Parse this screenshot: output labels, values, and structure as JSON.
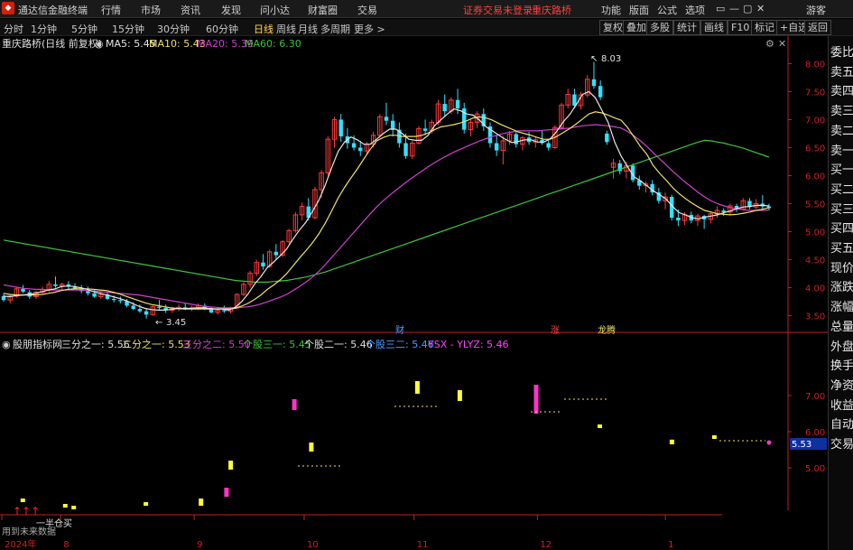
{
  "app": {
    "title": "通达信金融终端",
    "menu": [
      "行情",
      "市场",
      "资讯",
      "发现",
      "问小达",
      "财富圈",
      "交易"
    ],
    "status_left": "证券交易未登录",
    "status_stock": "重庆路桥",
    "menu_right": [
      "功能",
      "版面",
      "公式",
      "选项"
    ],
    "guest": "游客",
    "win_controls": [
      "▭",
      "—",
      "▢",
      "✕"
    ]
  },
  "tabs": [
    "分时",
    "1分钟",
    "5分钟",
    "15分钟",
    "30分钟",
    "60分钟",
    "日线",
    "周线",
    "月线",
    "多周期",
    "更多 >"
  ],
  "active_tab": "日线",
  "right_buttons": [
    "复权",
    "叠加",
    "多股",
    "统计",
    "画线",
    "F10",
    "标记",
    "+自选",
    "返回"
  ],
  "right_panel": [
    "委比",
    "卖五",
    "卖四",
    "卖三",
    "卖二",
    "卖一",
    "买一",
    "买二",
    "买三",
    "买四",
    "买五",
    "现价",
    "涨跌",
    "涨幅",
    "总量",
    "外盘",
    "换手",
    "净资",
    "收益",
    "自动",
    "交易"
  ],
  "main_header": {
    "name": "重庆路桥(日线 前复权)",
    "ma5": "MA5: 5.45",
    "ma10": "MA10: 5.43",
    "ma20": "MA20: 5.39",
    "ma60": "MA60: 6.30"
  },
  "sub_header": {
    "name": "股朋指标网",
    "s1": "三分之一: 5.56",
    "s2": "二分之一: 5.53",
    "s3": "三分之二: 5.50",
    "s4": "个股三一: 5.45",
    "s5": "个股二一: 5.46",
    "s6": "个股三二: 5.46",
    "s7": "YSX - YLYZ: 5.46"
  },
  "annotations": {
    "high_label": "8.03",
    "low_label": "3.45",
    "cai": "财",
    "zhang": "涨",
    "flags": "龙腾",
    "banner": "一半仓买",
    "notice": "用到未来数据",
    "current_price": "5.53"
  },
  "colors": {
    "up": "#ff3b3b",
    "down": "#33e0ff",
    "ma5": "#e6e6e6",
    "ma10": "#f0e068",
    "ma20": "#d040d0",
    "ma60": "#3cc43c",
    "axis": "#d02020",
    "sub_yellow": "#ffff33",
    "sub_magenta": "#ff33cc"
  },
  "chart_data": {
    "type": "candlestick",
    "title": "重庆路桥(日线 前复权)",
    "main_ylim": [
      3.3,
      8.2
    ],
    "main_yticks": [
      "8.00",
      "7.50",
      "7.00",
      "6.50",
      "6.00",
      "5.50",
      "5.00",
      "4.50",
      "4.00",
      "3.50"
    ],
    "sub_ylim": [
      3.8,
      8.2
    ],
    "sub_yticks": [
      "7.00",
      "6.00",
      "5.00"
    ],
    "x_labels": [
      "2024年",
      "8",
      "9",
      "10",
      "11",
      "12",
      "1"
    ],
    "candles": [
      [
        3.85,
        3.9,
        3.75,
        3.78
      ],
      [
        3.78,
        3.88,
        3.72,
        3.85
      ],
      [
        3.85,
        4.0,
        3.82,
        3.98
      ],
      [
        3.98,
        4.05,
        3.9,
        3.93
      ],
      [
        3.92,
        3.96,
        3.8,
        3.84
      ],
      [
        3.84,
        3.95,
        3.8,
        3.92
      ],
      [
        3.92,
        4.02,
        3.88,
        3.97
      ],
      [
        3.97,
        4.12,
        3.92,
        4.06
      ],
      [
        4.06,
        4.2,
        4.0,
        4.03
      ],
      [
        4.03,
        4.09,
        3.95,
        4.06
      ],
      [
        4.06,
        4.12,
        3.98,
        4.02
      ],
      [
        4.02,
        4.08,
        3.95,
        3.98
      ],
      [
        3.98,
        4.05,
        3.9,
        3.94
      ],
      [
        3.94,
        4.02,
        3.86,
        3.9
      ],
      [
        3.9,
        3.96,
        3.82,
        3.84
      ],
      [
        3.84,
        3.92,
        3.8,
        3.88
      ],
      [
        3.88,
        3.92,
        3.78,
        3.8
      ],
      [
        3.8,
        3.86,
        3.74,
        3.78
      ],
      [
        3.78,
        3.84,
        3.72,
        3.76
      ],
      [
        3.76,
        3.8,
        3.65,
        3.68
      ],
      [
        3.68,
        3.74,
        3.6,
        3.62
      ],
      [
        3.62,
        3.7,
        3.55,
        3.58
      ],
      [
        3.58,
        3.64,
        3.45,
        3.52
      ],
      [
        3.52,
        3.68,
        3.5,
        3.66
      ],
      [
        3.66,
        3.78,
        3.6,
        3.64
      ],
      [
        3.64,
        3.7,
        3.55,
        3.6
      ],
      [
        3.6,
        3.66,
        3.55,
        3.62
      ],
      [
        3.62,
        3.7,
        3.58,
        3.65
      ],
      [
        3.65,
        3.72,
        3.6,
        3.63
      ],
      [
        3.63,
        3.68,
        3.58,
        3.64
      ],
      [
        3.64,
        3.72,
        3.6,
        3.68
      ],
      [
        3.68,
        3.72,
        3.6,
        3.62
      ],
      [
        3.62,
        3.66,
        3.54,
        3.56
      ],
      [
        3.56,
        3.64,
        3.52,
        3.6
      ],
      [
        3.6,
        3.68,
        3.55,
        3.58
      ],
      [
        3.58,
        3.66,
        3.54,
        3.64
      ],
      [
        3.64,
        3.9,
        3.62,
        3.88
      ],
      [
        3.88,
        4.1,
        3.85,
        4.06
      ],
      [
        4.06,
        4.3,
        4.0,
        4.26
      ],
      [
        4.26,
        4.5,
        4.2,
        4.45
      ],
      [
        4.45,
        4.6,
        4.32,
        4.38
      ],
      [
        4.38,
        4.68,
        4.35,
        4.64
      ],
      [
        4.64,
        4.78,
        4.5,
        4.58
      ],
      [
        4.58,
        4.85,
        4.55,
        4.82
      ],
      [
        4.82,
        5.05,
        4.78,
        5.02
      ],
      [
        5.02,
        5.35,
        4.98,
        5.3
      ],
      [
        5.3,
        5.52,
        5.2,
        5.45
      ],
      [
        5.45,
        5.6,
        5.2,
        5.25
      ],
      [
        5.25,
        5.8,
        5.22,
        5.75
      ],
      [
        5.75,
        6.1,
        5.6,
        6.05
      ],
      [
        6.05,
        6.7,
        6.0,
        6.65
      ],
      [
        6.65,
        7.05,
        6.5,
        7.0
      ],
      [
        7.0,
        7.1,
        6.6,
        6.7
      ],
      [
        6.7,
        6.85,
        6.48,
        6.58
      ],
      [
        6.58,
        6.72,
        6.45,
        6.5
      ],
      [
        6.5,
        6.62,
        6.35,
        6.44
      ],
      [
        6.44,
        6.6,
        6.38,
        6.56
      ],
      [
        6.56,
        6.78,
        6.5,
        6.72
      ],
      [
        6.72,
        7.1,
        6.68,
        7.05
      ],
      [
        7.05,
        7.3,
        6.9,
        6.98
      ],
      [
        6.98,
        7.1,
        6.7,
        6.82
      ],
      [
        6.82,
        6.95,
        6.5,
        6.58
      ],
      [
        6.58,
        6.75,
        6.3,
        6.35
      ],
      [
        6.35,
        6.62,
        6.3,
        6.58
      ],
      [
        6.58,
        6.88,
        6.55,
        6.84
      ],
      [
        6.84,
        7.0,
        6.72,
        6.8
      ],
      [
        6.8,
        7.0,
        6.75,
        6.95
      ],
      [
        6.95,
        7.35,
        6.9,
        7.28
      ],
      [
        7.28,
        7.45,
        7.05,
        7.15
      ],
      [
        7.15,
        7.4,
        7.1,
        7.35
      ],
      [
        7.35,
        7.55,
        7.1,
        7.2
      ],
      [
        7.2,
        7.3,
        6.75,
        6.82
      ],
      [
        6.82,
        7.0,
        6.7,
        6.95
      ],
      [
        6.95,
        7.15,
        6.85,
        7.1
      ],
      [
        7.1,
        7.2,
        6.8,
        6.88
      ],
      [
        6.88,
        6.95,
        6.5,
        6.58
      ],
      [
        6.58,
        6.72,
        6.35,
        6.45
      ],
      [
        6.45,
        6.7,
        6.2,
        6.62
      ],
      [
        6.62,
        6.8,
        6.55,
        6.74
      ],
      [
        6.74,
        6.8,
        6.5,
        6.56
      ],
      [
        6.56,
        6.7,
        6.45,
        6.68
      ],
      [
        6.68,
        6.78,
        6.55,
        6.6
      ],
      [
        6.6,
        6.7,
        6.5,
        6.64
      ],
      [
        6.64,
        6.8,
        6.55,
        6.58
      ],
      [
        6.58,
        6.65,
        6.45,
        6.5
      ],
      [
        6.5,
        6.9,
        6.48,
        6.86
      ],
      [
        6.86,
        7.3,
        6.82,
        7.26
      ],
      [
        7.26,
        7.55,
        7.2,
        7.45
      ],
      [
        7.45,
        7.55,
        7.2,
        7.25
      ],
      [
        7.25,
        7.5,
        7.18,
        7.44
      ],
      [
        7.44,
        7.8,
        7.4,
        7.72
      ],
      [
        7.72,
        8.03,
        7.55,
        7.6
      ],
      [
        7.6,
        7.7,
        7.35,
        7.4
      ],
      [
        6.75,
        6.8,
        6.55,
        6.6
      ],
      [
        6.15,
        6.3,
        5.95,
        6.22
      ],
      [
        6.22,
        6.28,
        6.02,
        6.08
      ],
      [
        6.08,
        6.25,
        5.95,
        6.18
      ],
      [
        6.18,
        6.22,
        5.88,
        5.92
      ],
      [
        5.92,
        6.0,
        5.75,
        5.82
      ],
      [
        5.82,
        5.9,
        5.7,
        5.85
      ],
      [
        5.85,
        5.92,
        5.65,
        5.7
      ],
      [
        5.7,
        5.78,
        5.5,
        5.55
      ],
      [
        5.55,
        5.7,
        5.4,
        5.62
      ],
      [
        5.62,
        5.66,
        5.2,
        5.25
      ],
      [
        5.25,
        5.4,
        5.1,
        5.2
      ],
      [
        5.2,
        5.35,
        5.12,
        5.3
      ],
      [
        5.3,
        5.36,
        5.15,
        5.2
      ],
      [
        5.2,
        5.32,
        5.1,
        5.28
      ],
      [
        5.28,
        5.3,
        5.05,
        5.22
      ],
      [
        5.22,
        5.35,
        5.15,
        5.32
      ],
      [
        5.32,
        5.45,
        5.25,
        5.38
      ],
      [
        5.38,
        5.42,
        5.28,
        5.35
      ],
      [
        5.35,
        5.5,
        5.3,
        5.46
      ],
      [
        5.46,
        5.5,
        5.35,
        5.4
      ],
      [
        5.4,
        5.6,
        5.38,
        5.55
      ],
      [
        5.55,
        5.6,
        5.4,
        5.44
      ],
      [
        5.44,
        5.58,
        5.4,
        5.5
      ],
      [
        5.5,
        5.65,
        5.38,
        5.45
      ],
      [
        5.45,
        5.5,
        5.38,
        5.42
      ]
    ],
    "ma5": [
      3.85,
      3.84,
      3.86,
      3.87,
      3.88,
      3.9,
      3.93,
      3.96,
      3.98,
      4.02,
      4.03,
      4.02,
      4.0,
      3.97,
      3.93,
      3.9,
      3.87,
      3.84,
      3.81,
      3.77,
      3.72,
      3.67,
      3.63,
      3.61,
      3.6,
      3.6,
      3.61,
      3.63,
      3.63,
      3.63,
      3.64,
      3.64,
      3.63,
      3.62,
      3.62,
      3.6,
      3.65,
      3.75,
      3.89,
      4.06,
      4.2,
      4.36,
      4.46,
      4.57,
      4.69,
      4.87,
      5.03,
      5.17,
      5.36,
      5.56,
      5.83,
      6.14,
      6.43,
      6.6,
      6.69,
      6.64,
      6.56,
      6.56,
      6.65,
      6.75,
      6.83,
      6.83,
      6.75,
      6.65,
      6.63,
      6.63,
      6.72,
      6.89,
      7.0,
      7.1,
      7.19,
      7.16,
      7.1,
      7.08,
      6.99,
      6.87,
      6.8,
      6.72,
      6.65,
      6.59,
      6.61,
      6.64,
      6.64,
      6.6,
      6.6,
      6.66,
      6.79,
      6.96,
      7.09,
      7.26,
      7.45,
      7.5,
      7.39,
      7.17,
      6.95,
      6.6,
      6.35,
      6.16,
      5.98,
      5.91,
      5.82,
      5.73,
      5.66,
      5.58,
      5.45,
      5.34,
      5.3,
      5.25,
      5.23,
      5.26,
      5.28,
      5.3,
      5.34,
      5.37,
      5.41,
      5.44,
      5.45,
      5.47,
      5.47,
      5.46
    ],
    "ma10": [
      3.9,
      3.88,
      3.87,
      3.87,
      3.87,
      3.87,
      3.88,
      3.9,
      3.92,
      3.95,
      3.97,
      3.98,
      3.98,
      3.98,
      3.97,
      3.96,
      3.95,
      3.92,
      3.89,
      3.85,
      3.81,
      3.77,
      3.73,
      3.7,
      3.68,
      3.66,
      3.64,
      3.63,
      3.62,
      3.62,
      3.62,
      3.62,
      3.62,
      3.62,
      3.62,
      3.62,
      3.63,
      3.67,
      3.72,
      3.79,
      3.87,
      3.97,
      4.05,
      4.14,
      4.25,
      4.39,
      4.53,
      4.66,
      4.8,
      4.96,
      5.15,
      5.37,
      5.6,
      5.79,
      5.96,
      6.12,
      6.3,
      6.47,
      6.62,
      6.68,
      6.72,
      6.72,
      6.7,
      6.7,
      6.7,
      6.72,
      6.76,
      6.82,
      6.87,
      6.89,
      6.91,
      6.94,
      6.98,
      7.03,
      7.05,
      7.03,
      6.99,
      6.93,
      6.88,
      6.83,
      6.78,
      6.75,
      6.72,
      6.68,
      6.65,
      6.65,
      6.7,
      6.77,
      6.84,
      6.92,
      7.01,
      7.1,
      7.14,
      7.12,
      7.08,
      7.03,
      6.99,
      6.86,
      6.69,
      6.52,
      6.38,
      6.18,
      6.04,
      5.92,
      5.79,
      5.68,
      5.59,
      5.51,
      5.44,
      5.38,
      5.35,
      5.32,
      5.31,
      5.3,
      5.31,
      5.33,
      5.35,
      5.38,
      5.4,
      5.43
    ],
    "ma20": [
      4.05,
      4.03,
      4.01,
      3.99,
      3.98,
      3.97,
      3.97,
      3.96,
      3.96,
      3.96,
      3.96,
      3.96,
      3.96,
      3.95,
      3.94,
      3.93,
      3.92,
      3.91,
      3.9,
      3.89,
      3.88,
      3.87,
      3.85,
      3.83,
      3.81,
      3.79,
      3.77,
      3.75,
      3.73,
      3.71,
      3.69,
      3.67,
      3.66,
      3.65,
      3.64,
      3.64,
      3.64,
      3.65,
      3.66,
      3.68,
      3.71,
      3.75,
      3.79,
      3.83,
      3.88,
      3.95,
      4.02,
      4.1,
      4.19,
      4.29,
      4.41,
      4.54,
      4.67,
      4.8,
      4.93,
      5.06,
      5.19,
      5.32,
      5.44,
      5.55,
      5.65,
      5.74,
      5.83,
      5.92,
      6.0,
      6.08,
      6.16,
      6.23,
      6.3,
      6.36,
      6.42,
      6.47,
      6.52,
      6.57,
      6.62,
      6.66,
      6.7,
      6.73,
      6.76,
      6.78,
      6.8,
      6.8,
      6.8,
      6.8,
      6.81,
      6.82,
      6.83,
      6.84,
      6.85,
      6.87,
      6.89,
      6.9,
      6.91,
      6.9,
      6.89,
      6.87,
      6.85,
      6.79,
      6.71,
      6.62,
      6.52,
      6.41,
      6.3,
      6.19,
      6.08,
      5.98,
      5.88,
      5.79,
      5.7,
      5.62,
      5.55,
      5.5,
      5.46,
      5.43,
      5.41,
      5.39,
      5.38,
      5.38,
      5.38,
      5.39
    ],
    "ma60": [
      4.85,
      4.83,
      4.81,
      4.79,
      4.77,
      4.75,
      4.73,
      4.71,
      4.69,
      4.67,
      4.65,
      4.63,
      4.61,
      4.59,
      4.57,
      4.55,
      4.53,
      4.51,
      4.49,
      4.47,
      4.45,
      4.43,
      4.41,
      4.39,
      4.37,
      4.35,
      4.33,
      4.31,
      4.29,
      4.27,
      4.25,
      4.23,
      4.21,
      4.19,
      4.17,
      4.15,
      4.13,
      4.12,
      4.11,
      4.1,
      4.1,
      4.1,
      4.11,
      4.12,
      4.13,
      4.15,
      4.17,
      4.19,
      4.22,
      4.25,
      4.28,
      4.32,
      4.36,
      4.4,
      4.44,
      4.48,
      4.52,
      4.56,
      4.6,
      4.64,
      4.68,
      4.72,
      4.76,
      4.8,
      4.84,
      4.88,
      4.92,
      4.96,
      5.0,
      5.04,
      5.08,
      5.12,
      5.16,
      5.2,
      5.24,
      5.28,
      5.32,
      5.36,
      5.4,
      5.44,
      5.48,
      5.52,
      5.56,
      5.6,
      5.64,
      5.68,
      5.72,
      5.76,
      5.8,
      5.84,
      5.88,
      5.92,
      5.96,
      6.0,
      6.04,
      6.08,
      6.12,
      6.16,
      6.2,
      6.24,
      6.28,
      6.32,
      6.36,
      6.4,
      6.44,
      6.48,
      6.52,
      6.56,
      6.6,
      6.63,
      6.62,
      6.6,
      6.58,
      6.55,
      6.52,
      6.49,
      6.45,
      6.41,
      6.37,
      6.33
    ],
    "sub_bars": [
      {
        "i": 4,
        "lo": 4.05,
        "hi": 4.15,
        "c": "yellow"
      },
      {
        "i": 14,
        "lo": 3.9,
        "hi": 4.0,
        "c": "yellow"
      },
      {
        "i": 16,
        "lo": 3.85,
        "hi": 3.95,
        "c": "yellow"
      },
      {
        "i": 33,
        "lo": 3.95,
        "hi": 4.05,
        "c": "yellow"
      },
      {
        "i": 46,
        "lo": 3.95,
        "hi": 4.15,
        "c": "yellow"
      },
      {
        "i": 52,
        "lo": 4.2,
        "hi": 4.45,
        "c": "magenta"
      },
      {
        "i": 53,
        "lo": 4.95,
        "hi": 5.2,
        "c": "yellow"
      },
      {
        "i": 68,
        "lo": 6.6,
        "hi": 6.9,
        "c": "magenta"
      },
      {
        "i": 72,
        "lo": 5.45,
        "hi": 5.7,
        "c": "yellow"
      },
      {
        "i": 97,
        "lo": 7.05,
        "hi": 7.4,
        "c": "yellow"
      },
      {
        "i": 107,
        "lo": 6.85,
        "hi": 7.15,
        "c": "yellow"
      },
      {
        "i": 125,
        "lo": 6.5,
        "hi": 7.3,
        "c": "magenta"
      },
      {
        "i": 140,
        "lo": 6.1,
        "hi": 6.2,
        "c": "yellow"
      },
      {
        "i": 157,
        "lo": 5.65,
        "hi": 5.78,
        "c": "yellow"
      },
      {
        "i": 167,
        "lo": 5.8,
        "hi": 5.9,
        "c": "yellow"
      }
    ]
  }
}
